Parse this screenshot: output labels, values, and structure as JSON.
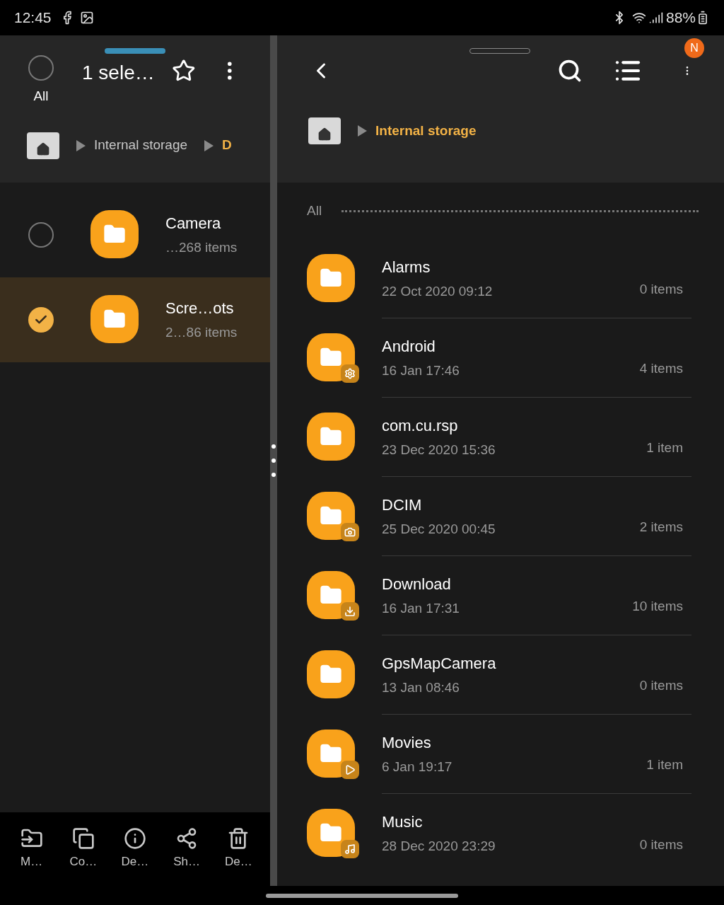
{
  "status_bar": {
    "time": "12:45",
    "battery": "88%"
  },
  "left_pane": {
    "select_all_label": "All",
    "select_all_checked": false,
    "title": "1 sele…",
    "breadcrumb": [
      {
        "label": "Internal storage",
        "current": false
      },
      {
        "label": "D",
        "current": true
      }
    ],
    "items": [
      {
        "name": "Camera",
        "count": "…268 items",
        "selected": false
      },
      {
        "name": "Scre…ots",
        "count": "2…86 items",
        "selected": true
      }
    ],
    "toolbar": [
      {
        "kind": "move",
        "label": "M…"
      },
      {
        "kind": "copy",
        "label": "Co…"
      },
      {
        "kind": "details",
        "label": "De…"
      },
      {
        "kind": "share",
        "label": "Sh…"
      },
      {
        "kind": "delete",
        "label": "De…"
      }
    ]
  },
  "right_pane": {
    "avatar": "N",
    "breadcrumb": [
      {
        "label": "Internal storage",
        "current": true
      }
    ],
    "section": "All",
    "folders": [
      {
        "name": "Alarms",
        "date": "22 Oct 2020 09:12",
        "count": "0 items"
      },
      {
        "name": "Android",
        "date": "16 Jan 17:46",
        "count": "4 items",
        "kind": "settings"
      },
      {
        "name": "com.cu.rsp",
        "date": "23 Dec 2020 15:36",
        "count": "1 item"
      },
      {
        "name": "DCIM",
        "date": "25 Dec 2020 00:45",
        "count": "2 items",
        "kind": "camera"
      },
      {
        "name": "Download",
        "date": "16 Jan 17:31",
        "count": "10 items",
        "kind": "download"
      },
      {
        "name": "GpsMapCamera",
        "date": "13 Jan 08:46",
        "count": "0 items"
      },
      {
        "name": "Movies",
        "date": "6 Jan 19:17",
        "count": "1 item",
        "kind": "video"
      },
      {
        "name": "Music",
        "date": "28 Dec 2020 23:29",
        "count": "0 items",
        "kind": "music"
      }
    ]
  }
}
